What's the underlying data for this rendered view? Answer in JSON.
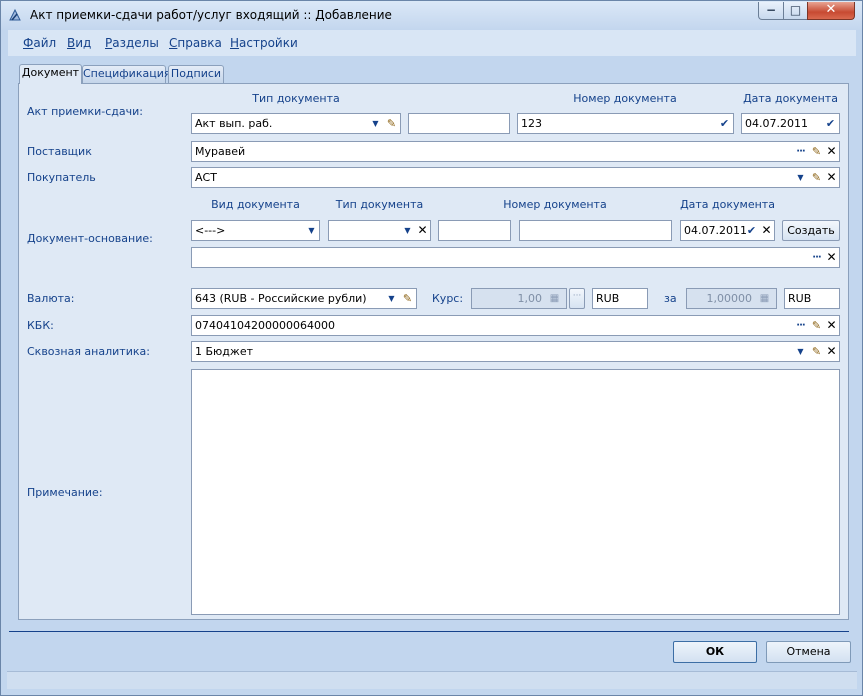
{
  "window": {
    "title": "Акт приемки-сдачи работ/услуг входящий :: Добавление",
    "controls": {
      "minimize": "−",
      "maximize": "□",
      "close": "✕"
    }
  },
  "menu": [
    "Файл",
    "Вид",
    "Разделы",
    "Справка",
    "Настройки"
  ],
  "menu_hotkeys": [
    "Ф",
    "В",
    "Р",
    "С",
    "Н"
  ],
  "menu_rest": [
    "айл",
    "ид",
    "азделы",
    "правка",
    "астройки"
  ],
  "tabs": [
    "Документ",
    "Спецификация",
    "Подписи"
  ],
  "act": {
    "label": "Акт приемки-сдачи:",
    "doc_type_header": "Тип документа",
    "doc_type_value": "Акт вып. раб.",
    "extra_value": "",
    "doc_number_header": "Номер документа",
    "doc_number_value": "123",
    "doc_date_header": "Дата документа",
    "doc_date_value": "04.07.2011"
  },
  "supplier": {
    "label": "Поставщик",
    "value": "Муравей"
  },
  "buyer": {
    "label": "Покупатель",
    "value": "АСТ"
  },
  "basis": {
    "label": "Документ-основание:",
    "kind_header": "Вид документа",
    "kind_value": "<--->",
    "type_header": "Тип документа",
    "type_value": "",
    "number_header": "Номер документа",
    "number_prefix": "",
    "number_value": "",
    "date_header": "Дата документа",
    "date_value": "04.07.2011",
    "create_button": "Создать",
    "second_value": ""
  },
  "currency": {
    "label": "Валюта:",
    "value": "643 (RUB - Российские рубли)",
    "rate_label": "Курс:",
    "rate_value": "1,00",
    "rate_currency": "RUB",
    "per_label": "за",
    "per_value": "1,00000",
    "per_currency": "RUB"
  },
  "kbk": {
    "label": "КБК:",
    "value": "07404104200000064000"
  },
  "analytics": {
    "label": "Сквозная аналитика:",
    "value": "1 Бюджет"
  },
  "note": {
    "label": "Примечание:",
    "value": ""
  },
  "buttons": {
    "ok": "ОК",
    "cancel": "Отмена"
  },
  "icons": {
    "dropdown": "▼",
    "pin": "✎",
    "clear": "✕",
    "dots": "···",
    "check": "✔",
    "calc": "▦"
  }
}
